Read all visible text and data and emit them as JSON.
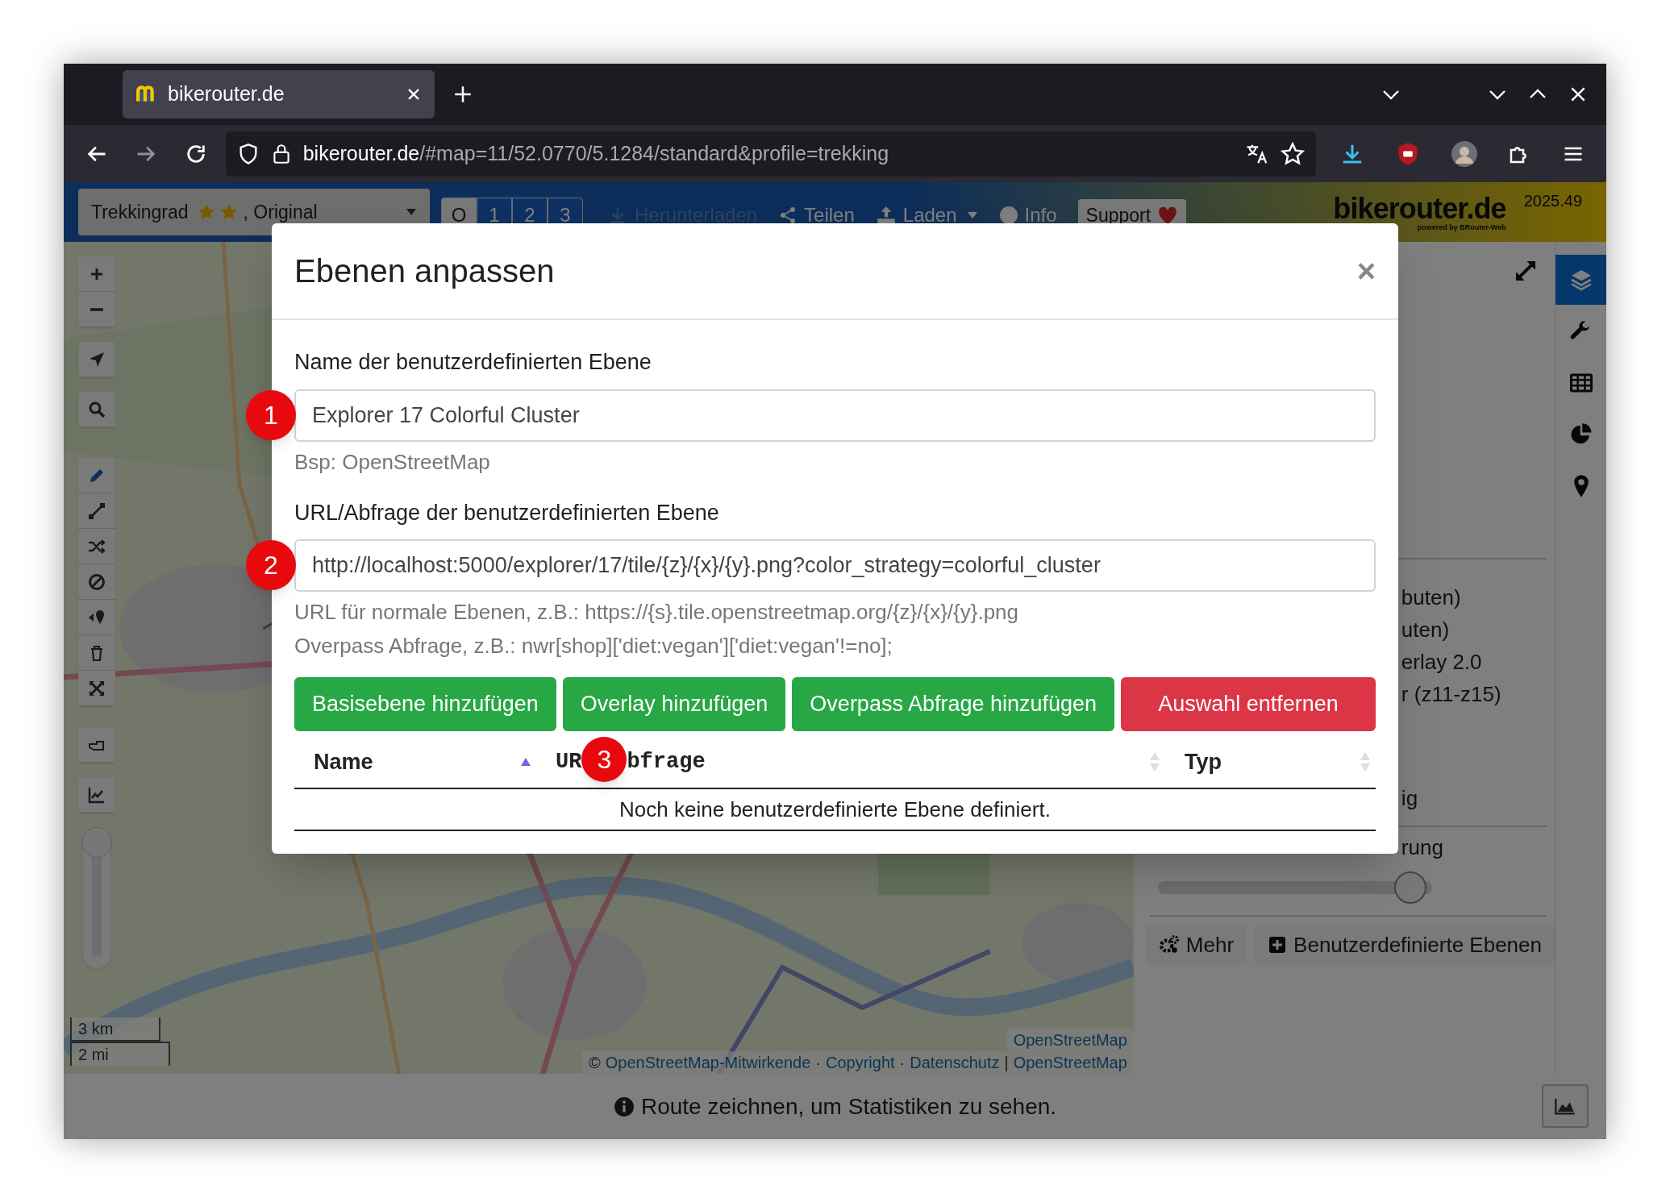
{
  "browser": {
    "tab_title": "bikerouter.de",
    "url_host": "bikerouter.de",
    "url_path": "/#map=11/52.0770/5.1284/standard&profile=trekking"
  },
  "toolbar": {
    "profile": {
      "name": "Trekkingrad",
      "suffix": ", Original"
    },
    "alternatives": [
      {
        "label": "O",
        "selected": true
      },
      {
        "label": "1",
        "selected": false
      },
      {
        "label": "2",
        "selected": false
      },
      {
        "label": "3",
        "selected": false
      }
    ],
    "actions": [
      {
        "label": "Herunterladen",
        "disabled": true,
        "dropdown": false
      },
      {
        "label": "Teilen",
        "disabled": false,
        "dropdown": false
      },
      {
        "label": "Laden",
        "disabled": false,
        "dropdown": true
      },
      {
        "label": "Info",
        "disabled": false,
        "dropdown": false
      }
    ],
    "support": "Support",
    "logo": "bikerouter.de",
    "logo_tagline": "powered by BRouter-Web",
    "version": "2025.49"
  },
  "map": {
    "zoom_slider": {
      "level": 1
    },
    "scale": [
      "3 km",
      "2 mi"
    ],
    "attribution_top": "OpenStreetMap",
    "attribution": [
      {
        "text": "©",
        "kind": "separator"
      },
      {
        "text": "OpenStreetMap-Mitwirkende",
        "kind": "link"
      },
      {
        "text": "·",
        "kind": "separator"
      },
      {
        "text": "Copyright",
        "kind": "link"
      },
      {
        "text": "·",
        "kind": "separator"
      },
      {
        "text": "Datenschutz",
        "kind": "link"
      },
      {
        "text": "|",
        "kind": "separator"
      },
      {
        "text": "OpenStreetMap",
        "kind": "link"
      }
    ]
  },
  "sidebar": {
    "tabs": [
      {
        "selected": true
      },
      {
        "selected": false
      },
      {
        "selected": false
      },
      {
        "selected": false
      },
      {
        "selected": false
      }
    ],
    "layer_list": [
      "buten)",
      "uten)",
      "erlay 2.0",
      "r (z11-z15)"
    ],
    "section_labels": [
      "ig",
      "rung"
    ],
    "opacity_slider": {
      "level": 0.92
    },
    "buttons": [
      {
        "label": "Mehr"
      },
      {
        "label": "Benutzerdefinierte Ebenen"
      }
    ]
  },
  "status_bar": {
    "message": "Route zeichnen, um Statistiken zu sehen."
  },
  "dialog": {
    "title": "Ebenen anpassen",
    "close": "×",
    "name_field": {
      "label": "Name der benutzerdefinierten Ebene",
      "value": "Explorer 17 Colorful Cluster",
      "help": [
        "Bsp: OpenStreetMap"
      ]
    },
    "url_field": {
      "label": "URL/Abfrage der benutzerdefinierten Ebene",
      "value": "http://localhost:5000/explorer/17/tile/{z}/{x}/{y}.png?color_strategy=colorful_cluster",
      "help": [
        "URL für normale Ebenen, z.B.: https://{s}.tile.openstreetmap.org/{z}/{x}/{y}.png",
        "Overpass Abfrage, z.B.: nwr[shop]['diet:vegan']['diet:vegan'!=no];"
      ]
    },
    "buttons": [
      {
        "label": "Basisebene hinzufügen",
        "kind": "success"
      },
      {
        "label": "Overlay hinzufügen",
        "kind": "success"
      },
      {
        "label": "Overpass Abfrage hinzufügen",
        "kind": "success"
      },
      {
        "label": "Auswahl entfernen",
        "kind": "danger"
      }
    ],
    "table": {
      "columns": [
        {
          "label": "Name",
          "sorted_ascending": true
        },
        {
          "label": "UR",
          "label_after_marker": "bfrage",
          "sorted_ascending": false
        },
        {
          "label": "Typ",
          "sorted_ascending": false
        }
      ],
      "empty_message": "Noch keine benutzerdefinierte Ebene definiert."
    }
  },
  "markers": [
    "1",
    "2",
    "3"
  ]
}
